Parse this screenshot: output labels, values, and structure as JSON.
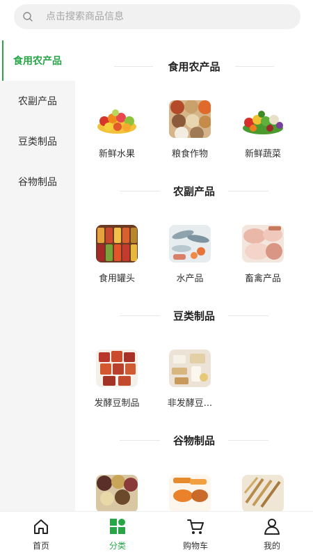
{
  "search": {
    "placeholder": "点击搜索商品信息"
  },
  "sidebar": {
    "items": [
      {
        "label": "食用农产品",
        "active": true
      },
      {
        "label": "农副产品",
        "active": false
      },
      {
        "label": "豆类制品",
        "active": false
      },
      {
        "label": "谷物制品",
        "active": false
      }
    ]
  },
  "sections": [
    {
      "title": "食用农产品",
      "items": [
        {
          "name": "新鲜水果"
        },
        {
          "name": "粮食作物"
        },
        {
          "name": "新鲜蔬菜"
        }
      ]
    },
    {
      "title": "农副产品",
      "items": [
        {
          "name": "食用罐头"
        },
        {
          "name": "水产品"
        },
        {
          "name": "畜禽产品"
        }
      ]
    },
    {
      "title": "豆类制品",
      "items": [
        {
          "name": "发酵豆制品"
        },
        {
          "name": "非发酵豆..."
        }
      ]
    },
    {
      "title": "谷物制品",
      "items": [
        {
          "name": ""
        },
        {
          "name": ""
        },
        {
          "name": ""
        }
      ]
    }
  ],
  "tabbar": {
    "items": [
      {
        "label": "首页",
        "icon": "home-icon"
      },
      {
        "label": "分类",
        "icon": "category-icon",
        "active": true
      },
      {
        "label": "购物车",
        "icon": "cart-icon"
      },
      {
        "label": "我的",
        "icon": "user-icon"
      }
    ]
  },
  "colors": {
    "accent": "#27a547",
    "sidebar_bg": "#f5f5f5",
    "search_bg": "#f1f1f1"
  }
}
